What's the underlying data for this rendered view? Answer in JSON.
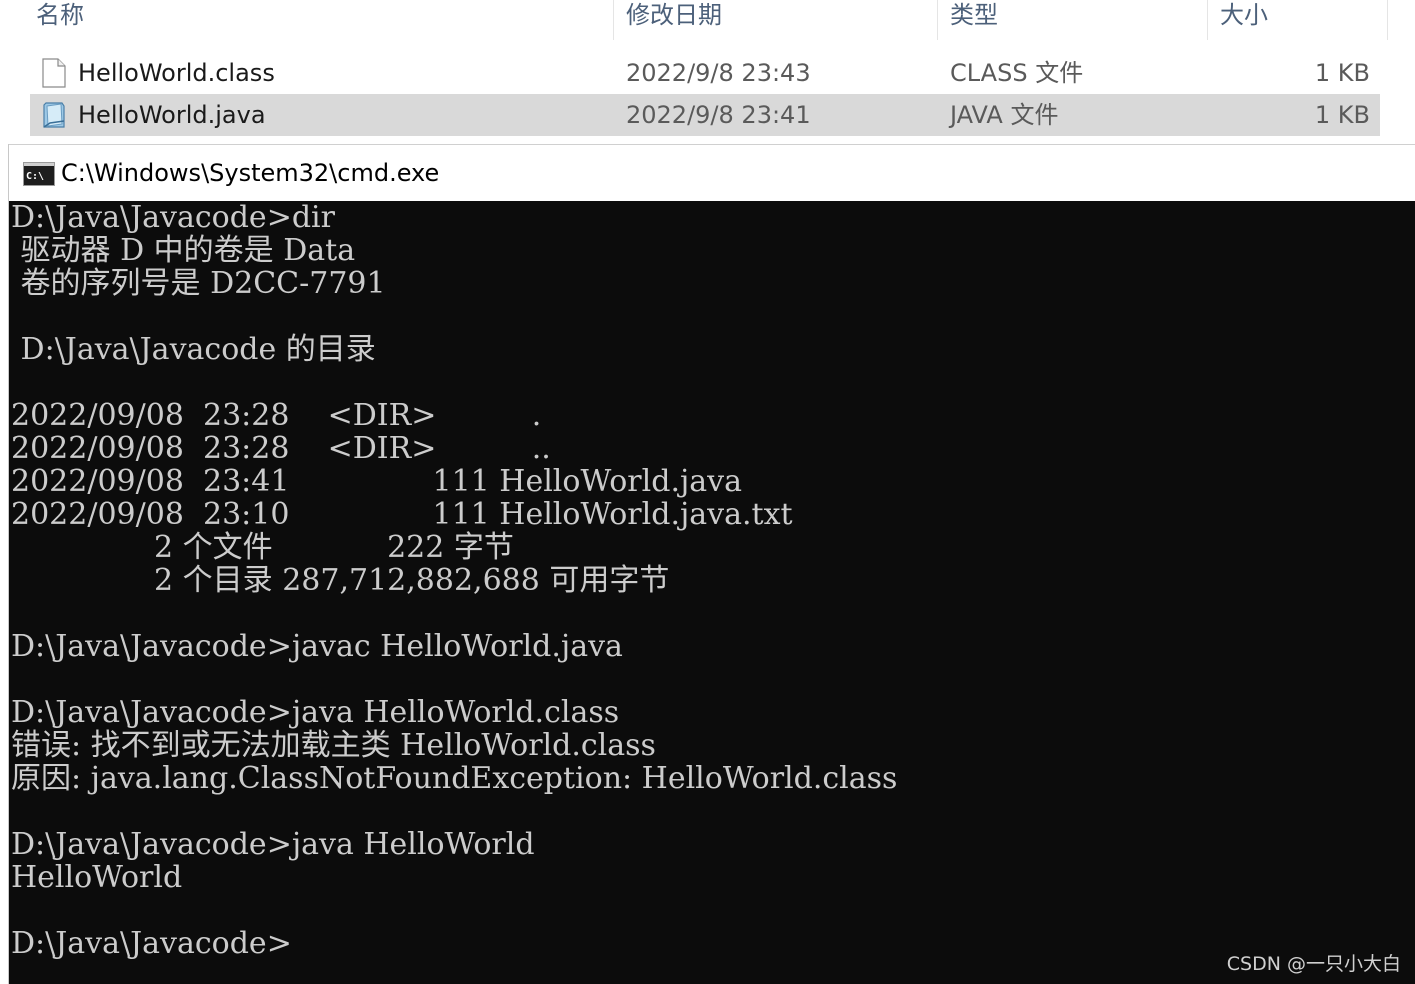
{
  "explorer": {
    "columns": {
      "name": "名称",
      "date": "修改日期",
      "type": "类型",
      "size": "大小"
    },
    "files": [
      {
        "name": "HelloWorld.class",
        "date": "2022/9/8 23:43",
        "type": "CLASS 文件",
        "size": "1 KB",
        "icon": "blank-file-icon"
      },
      {
        "name": "HelloWorld.java",
        "date": "2022/9/8 23:41",
        "type": "JAVA 文件",
        "size": "1 KB",
        "icon": "java-file-icon"
      }
    ]
  },
  "cmd": {
    "title": "C:\\Windows\\System32\\cmd.exe",
    "icon_label": "C:\\",
    "colors": {
      "background": "#0c0c0c",
      "text": "#cccccc"
    },
    "lines": [
      "D:\\Java\\Javacode>dir",
      " 驱动器 D 中的卷是 Data",
      " 卷的序列号是 D2CC-7791",
      "",
      " D:\\Java\\Javacode 的目录",
      "",
      "2022/09/08  23:28    <DIR>          .",
      "2022/09/08  23:28    <DIR>          ..",
      "2022/09/08  23:41               111 HelloWorld.java",
      "2022/09/08  23:10               111 HelloWorld.java.txt",
      "               2 个文件            222 字节",
      "               2 个目录 287,712,882,688 可用字节",
      "",
      "D:\\Java\\Javacode>javac HelloWorld.java",
      "",
      "D:\\Java\\Javacode>java HelloWorld.class",
      "错误: 找不到或无法加载主类 HelloWorld.class",
      "原因: java.lang.ClassNotFoundException: HelloWorld.class",
      "",
      "D:\\Java\\Javacode>java HelloWorld",
      "HelloWorld",
      "",
      "D:\\Java\\Javacode>"
    ]
  },
  "watermark": "CSDN @一只小大白"
}
